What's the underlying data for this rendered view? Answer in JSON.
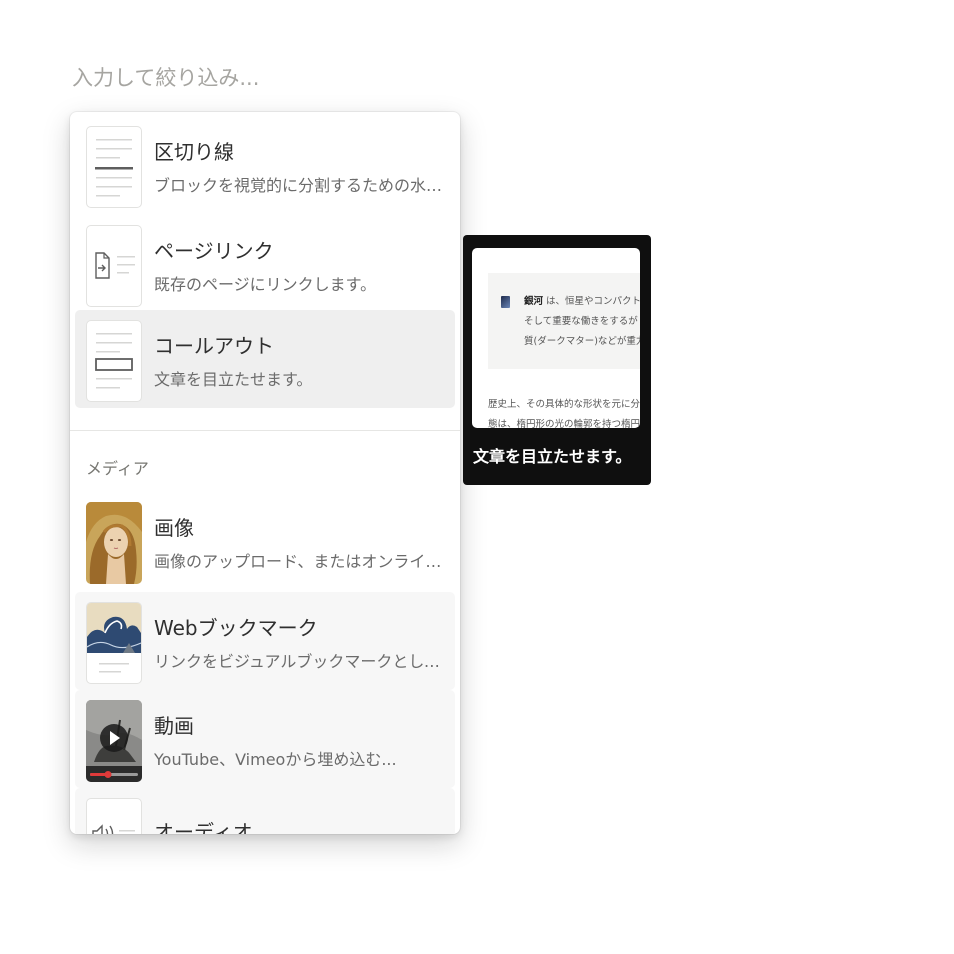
{
  "filter": {
    "placeholder": "入力して絞り込み..."
  },
  "menu": {
    "items": [
      {
        "id": "divider",
        "title": "区切り線",
        "description": "ブロックを視覚的に分割するための水平線...",
        "icon": "divider-thumbnail-icon"
      },
      {
        "id": "page-link",
        "title": "ページリンク",
        "description": "既存のページにリンクします。",
        "icon": "page-link-thumbnail-icon"
      },
      {
        "id": "callout",
        "title": "コールアウト",
        "description": "文章を目立たせます。",
        "icon": "callout-thumbnail-icon"
      }
    ],
    "media_section": {
      "header": "メディア",
      "items": [
        {
          "id": "image",
          "title": "画像",
          "description": "画像のアップロード、またはオンライン画...",
          "icon": "image-thumbnail-icon"
        },
        {
          "id": "web-bookmark",
          "title": "Webブックマーク",
          "description": "リンクをビジュアルブックマークとして保...",
          "icon": "bookmark-thumbnail-icon"
        },
        {
          "id": "video",
          "title": "動画",
          "description": "YouTube、Vimeoから埋め込む...",
          "icon": "video-thumbnail-icon"
        },
        {
          "id": "audio",
          "title": "オーディオ",
          "description": "",
          "icon": "audio-thumbnail-icon"
        }
      ]
    }
  },
  "tooltip": {
    "caption": "文章を目立たせます。",
    "preview": {
      "callout_bold": "銀河",
      "callout_lines": [
        "は、恒星やコンパクト",
        "そして重要な働きをするが",
        "質(ダークマター)などが重力"
      ],
      "body_lines": [
        "歴史上、その具体的な形状を元に分",
        "態は、楕円形の光の輪郭を持つ楕円"
      ]
    }
  },
  "colors": {
    "accent_hover": "#efefef",
    "tooltip_bg": "#0f0f0f",
    "video_progress": "#e03a3a"
  }
}
